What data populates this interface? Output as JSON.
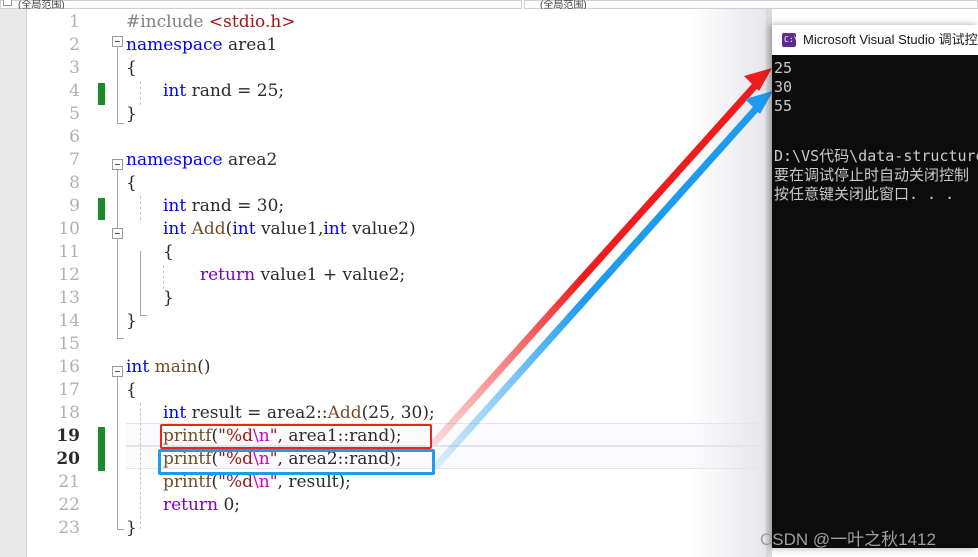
{
  "topbar": {
    "left_scope": "(全局范围)",
    "right_scope": "(全局范围)"
  },
  "editor": {
    "gutter_width": 26,
    "lines": [
      {
        "n": "1",
        "indent": 0,
        "current": false,
        "changed": false
      },
      {
        "n": "2",
        "indent": 0,
        "current": false,
        "changed": false
      },
      {
        "n": "3",
        "indent": 0,
        "current": false,
        "changed": false
      },
      {
        "n": "4",
        "indent": 0,
        "current": false,
        "changed": true
      },
      {
        "n": "5",
        "indent": 0,
        "current": false,
        "changed": false
      },
      {
        "n": "6",
        "indent": 0,
        "current": false,
        "changed": false
      },
      {
        "n": "7",
        "indent": 0,
        "current": false,
        "changed": false
      },
      {
        "n": "8",
        "indent": 0,
        "current": false,
        "changed": false
      },
      {
        "n": "9",
        "indent": 0,
        "current": false,
        "changed": true
      },
      {
        "n": "10",
        "indent": 0,
        "current": false,
        "changed": false
      },
      {
        "n": "11",
        "indent": 0,
        "current": false,
        "changed": false
      },
      {
        "n": "12",
        "indent": 0,
        "current": false,
        "changed": false
      },
      {
        "n": "13",
        "indent": 0,
        "current": false,
        "changed": false
      },
      {
        "n": "14",
        "indent": 0,
        "current": false,
        "changed": false
      },
      {
        "n": "15",
        "indent": 0,
        "current": false,
        "changed": false
      },
      {
        "n": "16",
        "indent": 0,
        "current": false,
        "changed": false
      },
      {
        "n": "17",
        "indent": 0,
        "current": false,
        "changed": false
      },
      {
        "n": "18",
        "indent": 0,
        "current": false,
        "changed": false
      },
      {
        "n": "19",
        "indent": 0,
        "current": true,
        "changed": true
      },
      {
        "n": "20",
        "indent": 0,
        "current": false,
        "changed": true
      },
      {
        "n": "21",
        "indent": 0,
        "current": false,
        "changed": false
      },
      {
        "n": "22",
        "indent": 0,
        "current": false,
        "changed": false
      },
      {
        "n": "23",
        "indent": 0,
        "current": false,
        "changed": false
      }
    ],
    "code": {
      "l1": "#include <stdio.h>",
      "l2": "namespace area1",
      "l3": "{",
      "l4": "int rand = 25;",
      "l5": "}",
      "l6": "",
      "l7": "namespace area2",
      "l8": "{",
      "l9": "int rand = 30;",
      "l10": "int Add(int value1, int value2)",
      "l11": "{",
      "l12": "return value1 + value2;",
      "l13": "}",
      "l14": "}",
      "l15": "",
      "l16": "int main()",
      "l17": "{",
      "l18": "int result = area2::Add(25, 30);",
      "l19": "printf(\"%d\\n\", area1::rand);",
      "l20": "printf(\"%d\\n\", area2::rand);",
      "l21": "printf(\"%d\\n\", result);",
      "l22": "return 0;",
      "l23": "}"
    },
    "tokens": {
      "include_directive": "#include",
      "include_header": "<stdio.h>",
      "kw_namespace": "namespace",
      "kw_int": "int",
      "kw_return": "return",
      "ns_area1": "area1",
      "ns_area2": "area2",
      "id_rand": "rand",
      "id_result": "result",
      "id_value1": "value1",
      "id_value2": "value2",
      "fn_add": "Add",
      "fn_main": "main",
      "fn_printf": "printf",
      "str_fmt": "\"%d",
      "esc_n": "\\n",
      "str_close": "\"",
      "num_25": "25",
      "num_30": "30",
      "num_0": "0",
      "brace_open": "{",
      "brace_close": "}",
      "semi": ";",
      "scope": "::"
    }
  },
  "annotations": {
    "red_box": {
      "label": "highlight-area1-rand-printf",
      "color": "#ee2222"
    },
    "blue_box": {
      "label": "highlight-area2-rand-printf",
      "color": "#1e9bef"
    },
    "red_arrow": {
      "label": "arrow-to-output-25",
      "color": "#ee1c1c"
    },
    "blue_arrow": {
      "label": "arrow-to-output-30",
      "color": "#1e9bef"
    }
  },
  "console": {
    "title": "Microsoft Visual Studio 调试控",
    "icon": "console-icon",
    "lines": [
      "25",
      "30",
      "55",
      "",
      "D:\\VS代码\\data-structure\\?",
      "要在调试停止时自动关闭控制",
      "按任意键关闭此窗口. . ."
    ]
  },
  "watermark": {
    "text": "CSDN @一叶之秋1412"
  }
}
